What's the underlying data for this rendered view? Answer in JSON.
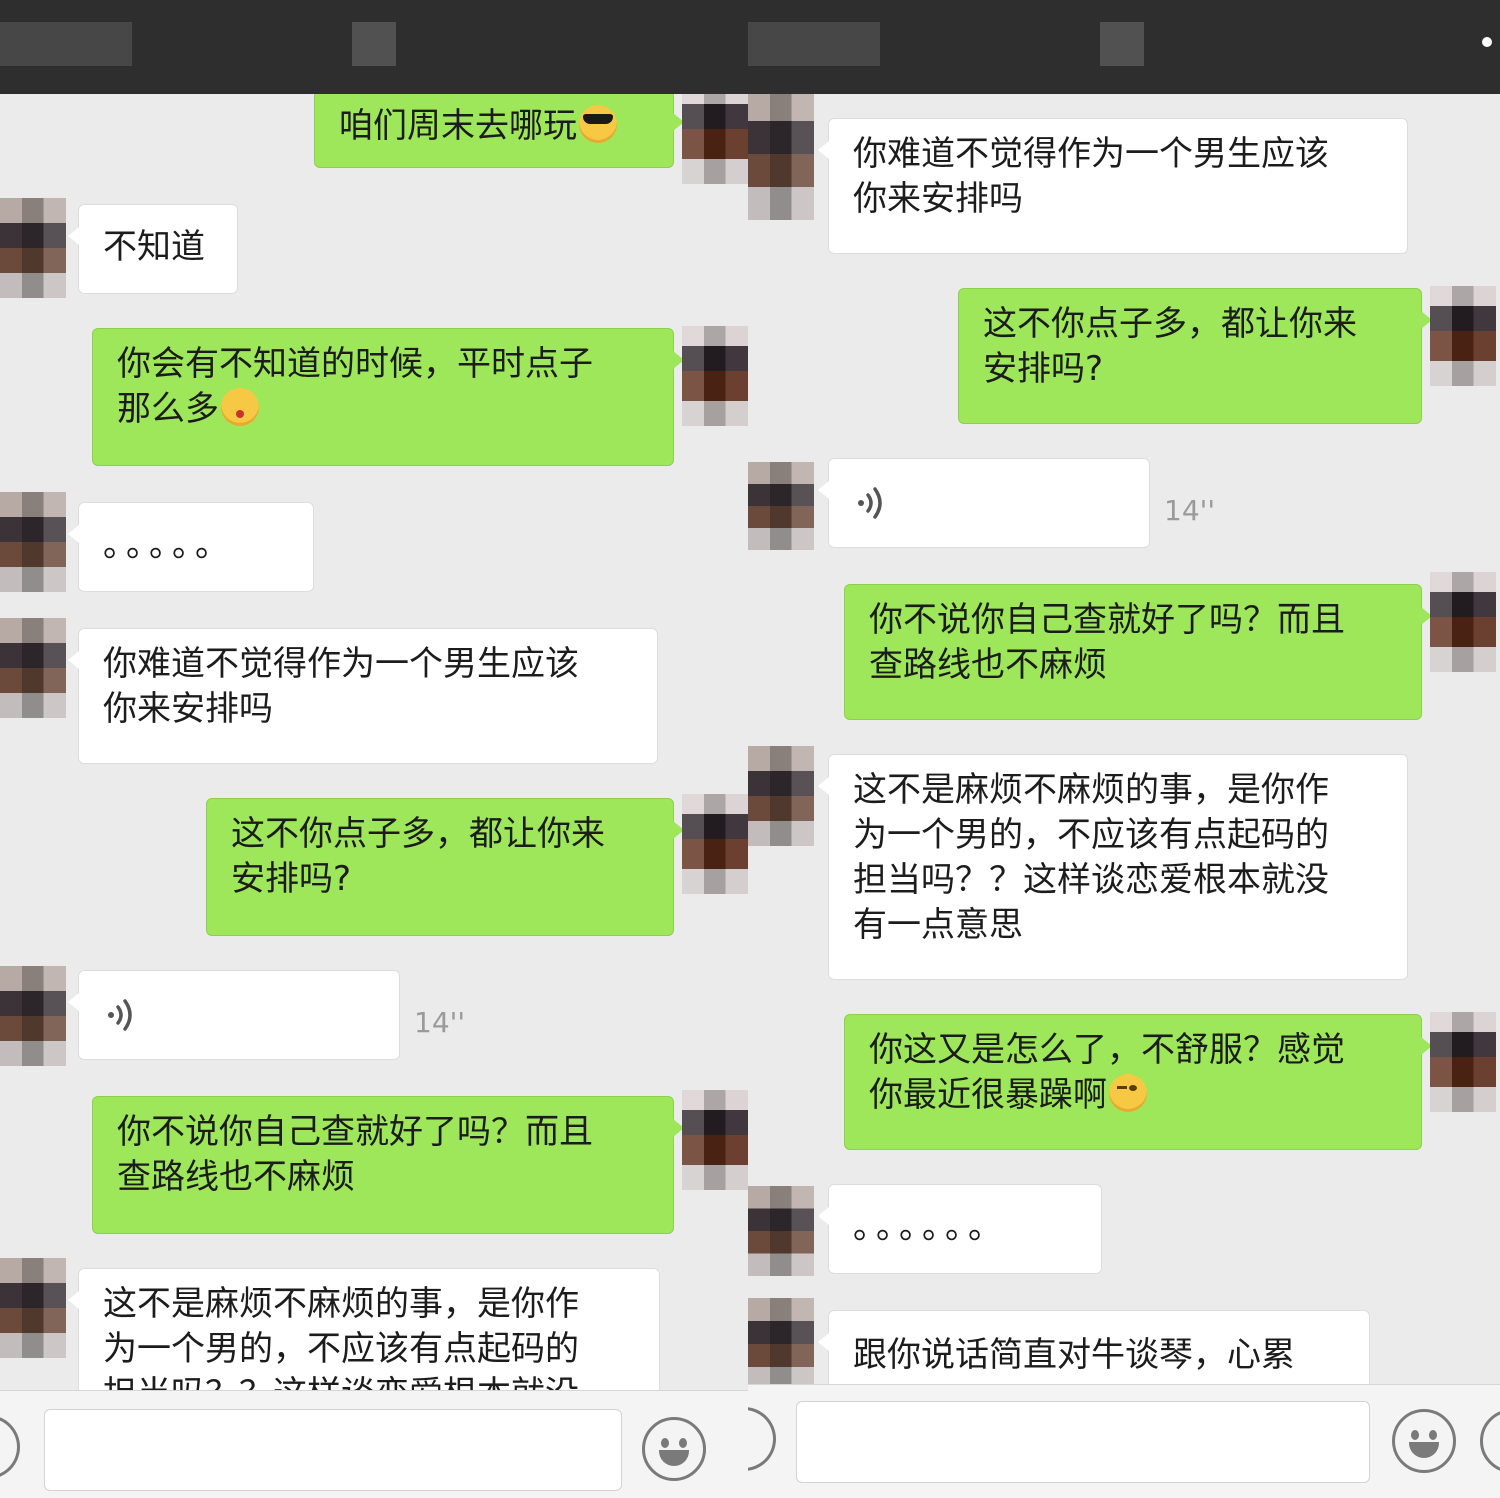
{
  "left": {
    "messages": [
      {
        "side": "out",
        "text": "咱们周末去哪玩",
        "emoji": "sunglasses-emoji"
      },
      {
        "side": "in",
        "text": "不知道"
      },
      {
        "side": "out",
        "text": "你会有不知道的时候，平时点子\n那么多",
        "emoji": "kiss-emoji"
      },
      {
        "side": "in",
        "text": "。。。。。"
      },
      {
        "side": "in",
        "text": "你难道不觉得作为一个男生应该\n你来安排吗"
      },
      {
        "side": "out",
        "text": "这不你点子多，都让你来\n安排吗?"
      },
      {
        "side": "in",
        "type": "voice",
        "duration": "14''"
      },
      {
        "side": "out",
        "text": "你不说你自己查就好了吗？而且\n查路线也不麻烦"
      },
      {
        "side": "in",
        "text": "这不是麻烦不麻烦的事，是你作\n为一个男的，不应该有点起码的\n担当吗？？这样谈恋爱根本就没\n有一点意思"
      }
    ]
  },
  "right": {
    "messages": [
      {
        "side": "in",
        "text": "你难道不觉得作为一个男生应该\n你来安排吗"
      },
      {
        "side": "out",
        "text": "这不你点子多，都让你来\n安排吗?"
      },
      {
        "side": "in",
        "type": "voice",
        "duration": "14''"
      },
      {
        "side": "out",
        "text": "你不说你自己查就好了吗？而且\n查路线也不麻烦"
      },
      {
        "side": "in",
        "text": "这不是麻烦不麻烦的事，是你作\n为一个男的，不应该有点起码的\n担当吗？？这样谈恋爱根本就没\n有一点意思"
      },
      {
        "side": "out",
        "text": "你这又是怎么了，不舒服？感觉\n你最近很暴躁啊",
        "emoji": "wink-emoji"
      },
      {
        "side": "in",
        "text": "。。。。。。"
      },
      {
        "side": "in",
        "text": "跟你说话简直对牛谈琴，心累"
      }
    ]
  },
  "colors": {
    "outgoing_bubble": "#9ee65a",
    "incoming_bubble": "#ffffff",
    "chat_background": "#ebebeb",
    "top_bar": "#2e2e2e"
  },
  "icons": {
    "voice": "voice-wave-icon",
    "emoji_button": "smiley-face-icon",
    "voice_button": "voice-toggle-icon",
    "more_button": "plus-icon"
  }
}
